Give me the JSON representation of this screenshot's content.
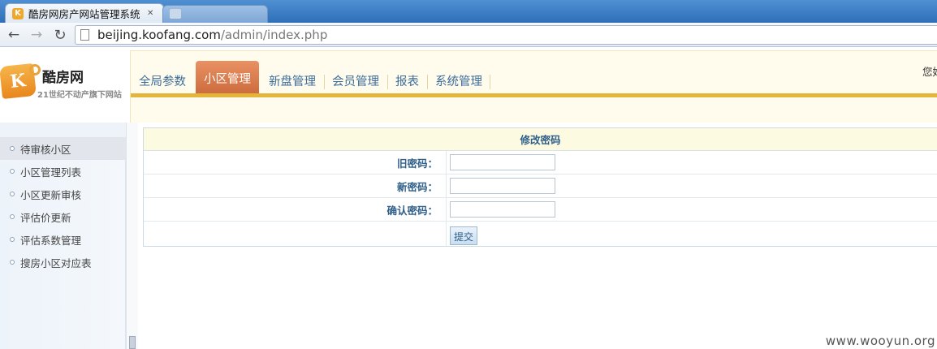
{
  "browser": {
    "active_tab": {
      "title": "酷房网房产网站管理系统",
      "close_glyph": "✕",
      "favicon_letter": "K"
    },
    "nav": {
      "back": "←",
      "forward": "→",
      "reload": "↻"
    },
    "address": {
      "host": "beijing.koofang.com",
      "path": "/admin/index.php"
    }
  },
  "header": {
    "logo_letter": "K",
    "brand_name": "酷房网",
    "slogan": "21世纪不动产旗下网站",
    "welcome": "您好",
    "menu": [
      {
        "label": "全局参数",
        "active": false
      },
      {
        "label": "小区管理",
        "active": true
      },
      {
        "label": "新盘管理",
        "active": false
      },
      {
        "label": "会员管理",
        "active": false
      },
      {
        "label": "报表",
        "active": false
      },
      {
        "label": "系统管理",
        "active": false
      }
    ]
  },
  "sidebar": {
    "items": [
      {
        "label": "待审核小区",
        "active": true
      },
      {
        "label": "小区管理列表",
        "active": false
      },
      {
        "label": "小区更新审核",
        "active": false
      },
      {
        "label": "评估价更新",
        "active": false
      },
      {
        "label": "评估系数管理",
        "active": false
      },
      {
        "label": "搜房小区对应表",
        "active": false
      }
    ]
  },
  "form": {
    "title": "修改密码",
    "fields": [
      {
        "label": "旧密码：",
        "value": ""
      },
      {
        "label": "新密码：",
        "value": ""
      },
      {
        "label": "确认密码：",
        "value": ""
      }
    ],
    "submit_label": "提交"
  },
  "watermark": "www.wooyun.org",
  "colors": {
    "nav_active": "#cc6a3c",
    "nav_goldbar": "#e3b53a",
    "label_blue": "#2f5f89",
    "nav_panel_bg": "#fffcee"
  }
}
